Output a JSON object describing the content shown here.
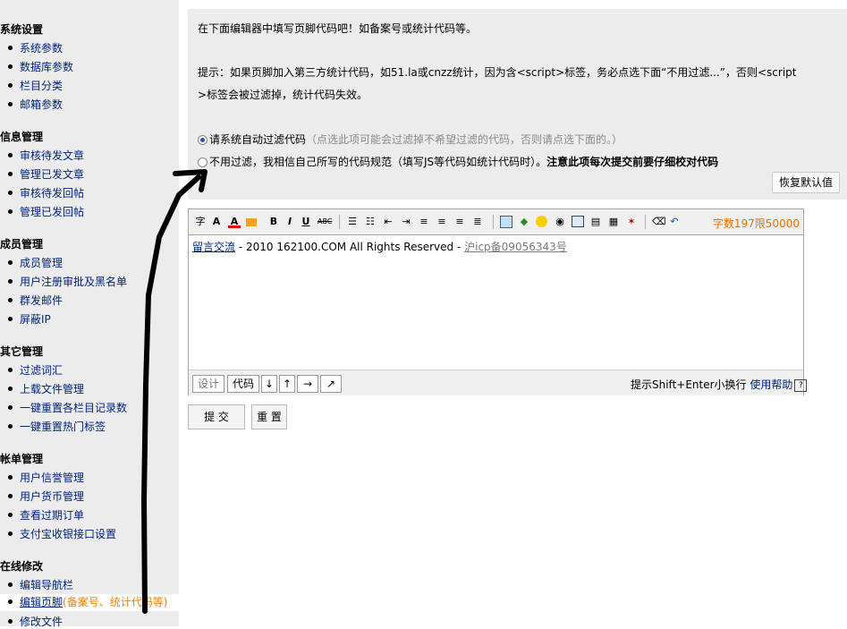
{
  "sidebar": {
    "sections": [
      {
        "title": "系统设置",
        "items": [
          "系统参数",
          "数据库参数",
          "栏目分类",
          "邮箱参数"
        ]
      },
      {
        "title": "信息管理",
        "items": [
          "审核待发文章",
          "管理已发文章",
          "审核待发回帖",
          "管理已发回帖"
        ]
      },
      {
        "title": "成员管理",
        "items": [
          "成员管理",
          "用户注册审批及黑名单",
          "群发邮件",
          "屏蔽IP"
        ]
      },
      {
        "title": "其它管理",
        "items": [
          "过滤词汇",
          "上载文件管理",
          "一键重置各栏目记录数",
          "一键重置热门标签"
        ]
      },
      {
        "title": "帐单管理",
        "items": [
          "用户信誉管理",
          "用户货币管理",
          "查看过期订单",
          "支付宝收银接口设置"
        ]
      },
      {
        "title": "在线修改",
        "items": [
          "编辑导航栏",
          "编辑页脚",
          "修改文件"
        ]
      }
    ],
    "active_hint": "(备案号、统计代码等)"
  },
  "info": {
    "line1": "在下面编辑器中填写页脚代码吧！如备案号或统计代码等。",
    "line2": "提示：如果页脚加入第三方统计代码，如51.la或cnzz统计，因为含<script>标签，务必点选下面“不用过滤...”，否则<script",
    "line3": ">标签会被过滤掉，统计代码失效。",
    "radio1_label": "请系统自动过滤代码",
    "radio1_note": "（点选此项可能会过滤掉不希望过滤的代码，否则请点选下面的。）",
    "radio2_label": "不用过滤，我相信自己所写的代码规范（填写JS等代码如统计代码时）。",
    "radio2_warning": "注意此项每次提交前要仔细校对代码",
    "restore_label": "恢复默认值"
  },
  "editor": {
    "char_count": "字数197限50000",
    "content": {
      "link1": "留言交流",
      "middle": " - 2010 162100.COM All Rights Reserved - ",
      "link2": "沪icp备09056343号"
    },
    "design_label": "设计",
    "code_label": "代码",
    "shift_hint": "提示Shift+Enter小换行",
    "help_label": "使用帮助",
    "help_icon_text": "?"
  },
  "buttons": {
    "submit": "提 交",
    "reset": "重 置"
  },
  "icons": {
    "toolbar": [
      "font-icon",
      "font-size-icon",
      "font-color-icon",
      "highlight-icon",
      "bold-icon",
      "italic-icon",
      "underline-icon",
      "strikethrough-icon",
      "ordered-list-icon",
      "unordered-list-icon",
      "outdent-icon",
      "indent-icon",
      "align-left-icon",
      "align-center-icon",
      "align-right-icon",
      "align-justify-icon",
      "image-icon",
      "upload-icon",
      "emoticon-icon",
      "media-icon",
      "table-icon",
      "hr-icon",
      "special-char-icon",
      "flash-icon",
      "eraser-icon",
      "undo-icon"
    ]
  }
}
